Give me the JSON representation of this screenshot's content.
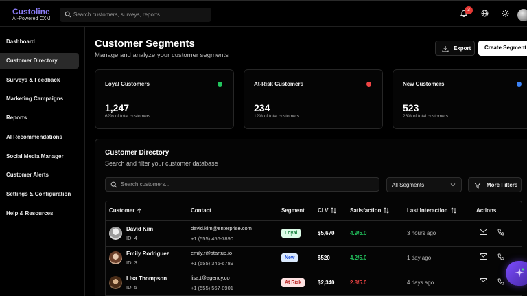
{
  "brand": {
    "name": "Custoline",
    "tagline": "AI-Powered CXM",
    "accent": "#8b7cf6"
  },
  "topbar": {
    "search_placeholder": "Search customers, surveys, reports...",
    "notification_count": "3"
  },
  "sidebar": {
    "items": [
      {
        "label": "Dashboard",
        "active": false
      },
      {
        "label": "Customer Directory",
        "active": true
      },
      {
        "label": "Surveys & Feedback",
        "active": false
      },
      {
        "label": "Marketing Campaigns",
        "active": false
      },
      {
        "label": "Reports",
        "active": false
      },
      {
        "label": "AI Recommendations",
        "active": false
      },
      {
        "label": "Social Media Manager",
        "active": false
      },
      {
        "label": "Customer Alerts",
        "active": false
      },
      {
        "label": "Settings & Configuration",
        "active": false
      },
      {
        "label": "Help & Resources",
        "active": false
      }
    ]
  },
  "page": {
    "title": "Customer Segments",
    "subtitle": "Manage and analyze your customer segments",
    "export_label": "Export",
    "create_label": "Create Segment"
  },
  "cards": [
    {
      "title": "Loyal Customers",
      "value": "1,247",
      "pct": "62% of total customers",
      "dot_color": "#22c55e"
    },
    {
      "title": "At-Risk Customers",
      "value": "234",
      "pct": "12% of total customers",
      "dot_color": "#ef4444"
    },
    {
      "title": "New Customers",
      "value": "523",
      "pct": "26% of total customers",
      "dot_color": "#3b82f6"
    }
  ],
  "directory": {
    "title": "Customer Directory",
    "subtitle": "Search and filter your customer database",
    "search_placeholder": "Search customers...",
    "segment_filter": "All Segments",
    "more_filters_label": "More Filters",
    "columns": [
      "Customer",
      "Contact",
      "Segment",
      "CLV",
      "Satisfaction",
      "Last Interaction",
      "Actions"
    ],
    "rows": [
      {
        "name": "David Kim",
        "id": "ID: 4",
        "email": "david.kim@enterprise.com",
        "phone": "+1 (555) 456-7890",
        "segment": "Loyal",
        "clv": "$5,670",
        "satisfaction": "4.9/5.0",
        "last": "3 hours ago"
      },
      {
        "name": "Emily Rodriguez",
        "id": "ID: 3",
        "email": "emily.r@startup.io",
        "phone": "+1 (555) 345-6789",
        "segment": "New",
        "clv": "$520",
        "satisfaction": "4.2/5.0",
        "last": "1 day ago"
      },
      {
        "name": "Lisa Thompson",
        "id": "ID: 5",
        "email": "lisa.t@agency.co",
        "phone": "+1 (555) 567-8901",
        "segment": "At Risk",
        "clv": "$2,340",
        "satisfaction": "2.8/5.0",
        "last": "4 days ago"
      }
    ]
  },
  "colors": {
    "loyal_badge_bg": "#dcfce7",
    "loyal_badge_fg": "#15803d",
    "new_badge_bg": "#dbeafe",
    "new_badge_fg": "#1d4ed8",
    "risk_badge_bg": "#fee2e2",
    "risk_badge_fg": "#b91c1c",
    "sat_good": "#22c55e",
    "sat_bad": "#ef4444"
  }
}
